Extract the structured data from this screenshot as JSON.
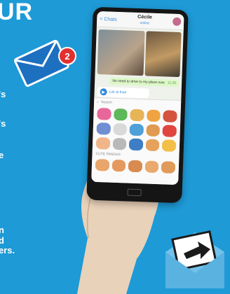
{
  "headline": "UR",
  "badge_count": "2",
  "side_text": [
    "'s",
    "'s",
    "e",
    "n",
    "d",
    "ers."
  ],
  "chat": {
    "back_label": "< Chats",
    "contact_name": "Cécile",
    "status": "online",
    "message_text": "No need to drive to my place now",
    "message_time": "11:36",
    "voice_label": "Lok at that!",
    "voice_time": "0:07"
  },
  "stickers": {
    "search_placeholder": "Search",
    "section_label": "CUTE PANDAS"
  },
  "colors": {
    "background": "#1e9ad6",
    "badge": "#e0312f",
    "bubble_out": "#dcf8c6",
    "accent": "#2f8ae0"
  }
}
